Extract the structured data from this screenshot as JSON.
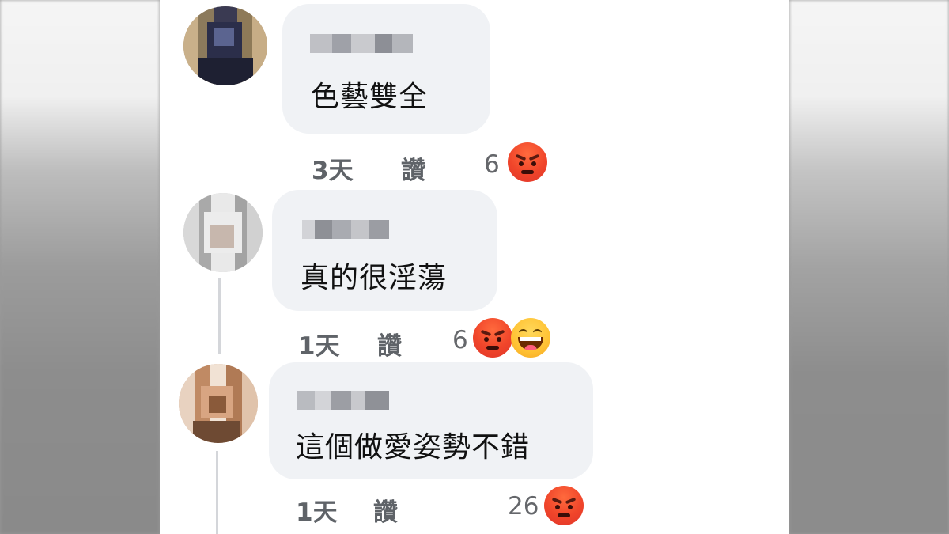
{
  "comments": [
    {
      "text": "色藝雙全",
      "time": "3天",
      "like_label": "讚",
      "reaction_count": "6",
      "reactions": [
        "angry-icon"
      ]
    },
    {
      "text": "真的很淫蕩",
      "time": "1天",
      "like_label": "讚",
      "reaction_count": "6",
      "reactions": [
        "angry-icon",
        "haha-icon"
      ]
    },
    {
      "text": "這個做愛姿勢不錯",
      "time": "1天",
      "like_label": "讚",
      "reaction_count": "26",
      "reactions": [
        "angry-icon"
      ]
    }
  ],
  "colors": {
    "bubble": "#f0f2f5",
    "angry": "#f0452a",
    "haha": "#ffc233",
    "meta_text": "#65676b"
  }
}
